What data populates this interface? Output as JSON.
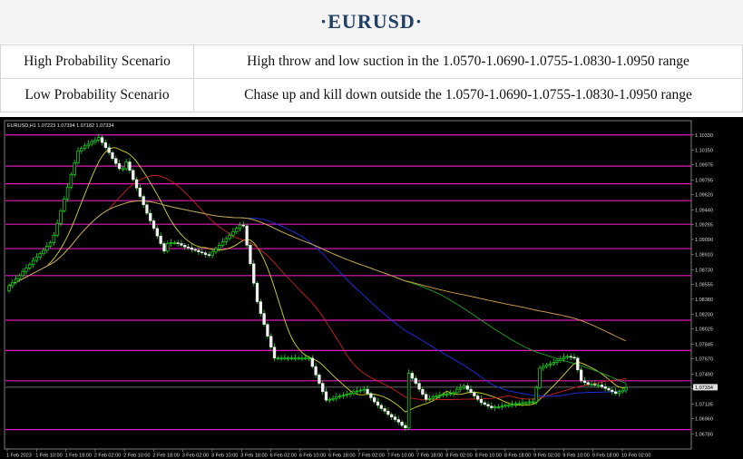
{
  "title": "·EURUSD·",
  "scenarios": [
    {
      "label": "High Probability Scenario",
      "text": "High throw and low suction in the 1.0570-1.0690-1.0755-1.0830-1.0950 range"
    },
    {
      "label": "Low Probability Scenario",
      "text": "Chase up and kill down outside the 1.0570-1.0690-1.0755-1.0830-1.0950 range"
    }
  ],
  "chart_header": "EURUSD,H1  1.07223 1.07394 1.07182 1.07334",
  "chart_data": {
    "type": "candlestick",
    "symbol": "EURUSD",
    "timeframe": "H1",
    "ylim": [
      1.066,
      1.105
    ],
    "price_ticks": [
      "1.10330",
      "1.10150",
      "1.09975",
      "1.09795",
      "1.09620",
      "1.09440",
      "1.09265",
      "1.09090",
      "1.08910",
      "1.08730",
      "1.08555",
      "1.08380",
      "1.08200",
      "1.08025",
      "1.07845",
      "1.07670",
      "1.07490",
      "1.07315",
      "1.07135",
      "1.06960",
      "1.06780"
    ],
    "time_ticks": [
      "1 Feb 2023",
      "1 Feb 10:00",
      "1 Feb 18:00",
      "2 Feb 02:00",
      "2 Feb 10:00",
      "2 Feb 18:00",
      "3 Feb 02:00",
      "3 Feb 10:00",
      "3 Feb 18:00",
      "6 Feb 02:00",
      "6 Feb 10:00",
      "6 Feb 18:00",
      "7 Feb 02:00",
      "7 Feb 10:00",
      "7 Feb 18:00",
      "8 Feb 02:00",
      "8 Feb 10:00",
      "8 Feb 18:00",
      "9 Feb 02:00",
      "9 Feb 10:00",
      "9 Feb 18:00",
      "10 Feb 02:00"
    ],
    "current_price": "1.07334",
    "levels": [
      1.1033,
      1.0996,
      1.0975,
      1.0955,
      1.0927,
      1.0898,
      1.0866,
      1.0813,
      1.0777,
      1.0741,
      1.0683
    ],
    "closes": [
      1.0854,
      1.0858,
      1.0862,
      1.0866,
      1.0871,
      1.0875,
      1.0879,
      1.0884,
      1.0888,
      1.0892,
      1.0896,
      1.0901,
      1.0905,
      1.0914,
      1.0928,
      1.0943,
      1.0957,
      1.0971,
      1.0986,
      1.1,
      1.1014,
      1.1017,
      1.102,
      1.1022,
      1.1025,
      1.1027,
      1.103,
      1.1024,
      1.1018,
      1.1012,
      1.1005,
      1.0999,
      1.0993,
      1.0993,
      1.1001,
      1.0991,
      1.098,
      1.097,
      1.096,
      1.095,
      1.094,
      1.0931,
      1.0922,
      1.0913,
      1.0904,
      1.0895,
      1.0904,
      1.0905,
      1.0905,
      1.0904,
      1.0902,
      1.09,
      1.0899,
      1.0897,
      1.0896,
      1.0894,
      1.0893,
      1.0891,
      1.089,
      1.0894,
      1.0898,
      1.0902,
      1.0906,
      1.091,
      1.0914,
      1.0918,
      1.0922,
      1.0926,
      1.0925,
      1.0902,
      1.088,
      1.0857,
      1.0835,
      1.0821,
      1.0808,
      1.0794,
      1.0781,
      1.0768,
      1.0768,
      1.0768,
      1.0768,
      1.0768,
      1.0768,
      1.0768,
      1.0768,
      1.0768,
      1.0768,
      1.0768,
      1.0758,
      1.0748,
      1.0738,
      1.0728,
      1.0718,
      1.0719,
      1.072,
      1.0722,
      1.0723,
      1.0724,
      1.0725,
      1.0726,
      1.0728,
      1.0729,
      1.073,
      1.0731,
      1.0726,
      1.0721,
      1.0716,
      1.0712,
      1.0708,
      1.0705,
      1.0701,
      1.0698,
      1.0695,
      1.0692,
      1.0688,
      1.0685,
      1.075,
      1.0744,
      1.0738,
      1.0731,
      1.0725,
      1.0719,
      1.072,
      1.0722,
      1.0723,
      1.0724,
      1.0725,
      1.0725,
      1.0726,
      1.0727,
      1.0731,
      1.0733,
      1.0735,
      1.0731,
      1.0727,
      1.0723,
      1.0719,
      1.0715,
      1.0713,
      1.0711,
      1.0709,
      1.071,
      1.071,
      1.0711,
      1.0712,
      1.0712,
      1.0713,
      1.0714,
      1.0714,
      1.0715,
      1.0715,
      1.0716,
      1.0716,
      1.0733,
      1.0756,
      1.0758,
      1.076,
      1.0761,
      1.0763,
      1.0765,
      1.0767,
      1.0769,
      1.077,
      1.0769,
      1.0768,
      1.0754,
      1.0741,
      1.0739,
      1.0737,
      1.0737,
      1.0736,
      1.0736,
      1.0734,
      1.0732,
      1.073,
      1.0728,
      1.0726,
      1.0728,
      1.073,
      1.0733
    ]
  }
}
